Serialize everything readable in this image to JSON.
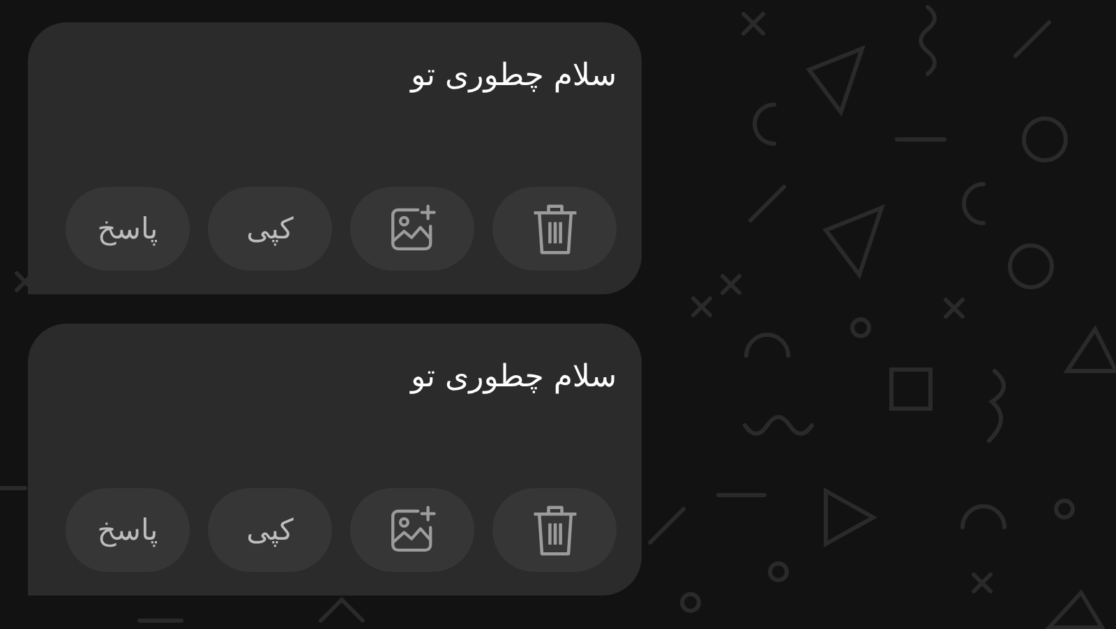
{
  "messages": [
    {
      "text": "سلام چطوری تو",
      "actions": [
        {
          "kind": "delete"
        },
        {
          "kind": "add-image"
        },
        {
          "kind": "label",
          "label": "کپی"
        },
        {
          "kind": "label",
          "label": "پاسخ"
        }
      ]
    },
    {
      "text": "سلام چطوری تو",
      "actions": [
        {
          "kind": "delete"
        },
        {
          "kind": "add-image"
        },
        {
          "kind": "label",
          "label": "کپی"
        },
        {
          "kind": "label",
          "label": "پاسخ"
        }
      ]
    }
  ]
}
